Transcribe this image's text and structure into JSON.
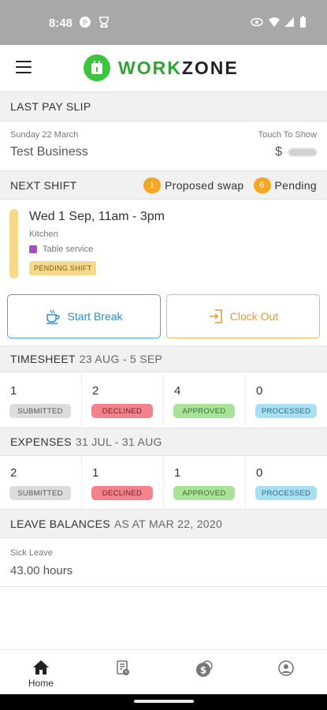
{
  "status_bar": {
    "time": "8:48"
  },
  "app": {
    "brand_work": "WORK",
    "brand_zone": "ZONE"
  },
  "last_pay_slip": {
    "header": "LAST PAY SLIP",
    "date": "Sunday 22 March",
    "business": "Test Business",
    "touch_label": "Touch To Show",
    "currency": "$"
  },
  "next_shift": {
    "header": "NEXT SHIFT",
    "proposed_count": "1",
    "proposed_label": "Proposed swap",
    "pending_count": "6",
    "pending_label": "Pending",
    "time": "Wed 1 Sep, 11am - 3pm",
    "area": "Kitchen",
    "role": "Table service",
    "status_tag": "PENDING SHIFT",
    "colors": {
      "shift_bar": "#f7d98c",
      "role_dot": "#a64dbf",
      "badge": "#f5a623"
    }
  },
  "actions": {
    "start_break": "Start Break",
    "clock_out": "Clock Out"
  },
  "timesheet": {
    "title": "TIMESHEET",
    "range": "23 AUG - 5 SEP",
    "stats": [
      {
        "count": "1",
        "label": "SUBMITTED"
      },
      {
        "count": "2",
        "label": "DECLINED"
      },
      {
        "count": "4",
        "label": "APPROVED"
      },
      {
        "count": "0",
        "label": "PROCESSED"
      }
    ]
  },
  "expenses": {
    "title": "EXPENSES",
    "range": "31 JUL - 31 AUG",
    "stats": [
      {
        "count": "2",
        "label": "SUBMITTED"
      },
      {
        "count": "1",
        "label": "DECLINED"
      },
      {
        "count": "1",
        "label": "APPROVED"
      },
      {
        "count": "0",
        "label": "PROCESSED"
      }
    ]
  },
  "leave_balances": {
    "title": "LEAVE BALANCES",
    "as_at": "AS AT MAR 22, 2020",
    "type": "Sick Leave",
    "value": "43.00 hours"
  },
  "bottom_nav": {
    "items": [
      {
        "icon": "home-icon",
        "label": "Home"
      },
      {
        "icon": "timesheet-icon"
      },
      {
        "icon": "money-icon"
      },
      {
        "icon": "profile-icon"
      }
    ]
  }
}
